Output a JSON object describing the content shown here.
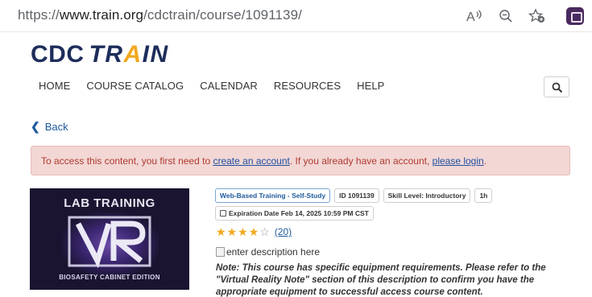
{
  "browser": {
    "url_prefix": "https://",
    "url_host": "www.train.org",
    "url_path": "/cdctrain/course/1091139/",
    "read_aloud_icon": "read-aloud-icon",
    "zoom_icon": "zoom-out-icon",
    "favorite_icon": "add-favorite-icon",
    "extension_icon": "extension-icon"
  },
  "site": {
    "logo_cdc": "CDC",
    "logo_train_pre": "TR",
    "logo_train_a": "A",
    "logo_train_post": "IN",
    "nav": [
      "HOME",
      "COURSE CATALOG",
      "CALENDAR",
      "RESOURCES",
      "HELP"
    ],
    "search_icon": "search-icon"
  },
  "page": {
    "back_label": "Back",
    "alert": {
      "pre": "To access this content, you first need to ",
      "link1": "create an account",
      "mid": ". If you already have an account, ",
      "link2": "please login",
      "post": "."
    },
    "course_image": {
      "top_text": "LAB TRAINING",
      "bottom_text": "BIOSAFETY CABINET EDITION"
    },
    "tags": [
      "Web-Based Training - Self-Study",
      "ID 1091139",
      "Skill Level: Introductory",
      "1h"
    ],
    "expiration": "Expiration Date Feb 14, 2025 10:59 PM CST",
    "rating": {
      "stars": 4,
      "max": 5,
      "count": "(20)"
    },
    "image_alt": "enter description here",
    "note": "Note: This course has specific equipment requirements. Please refer to the \"Virtual Reality Note\" section of this description to confirm you have the appropriate equipment to successful access course content."
  },
  "colors": {
    "brand_navy": "#1d2d5b",
    "brand_gold": "#f2a81d",
    "link_blue": "#1f5a9c",
    "alert_bg": "#f2d7d5",
    "alert_text": "#b03a2e"
  }
}
